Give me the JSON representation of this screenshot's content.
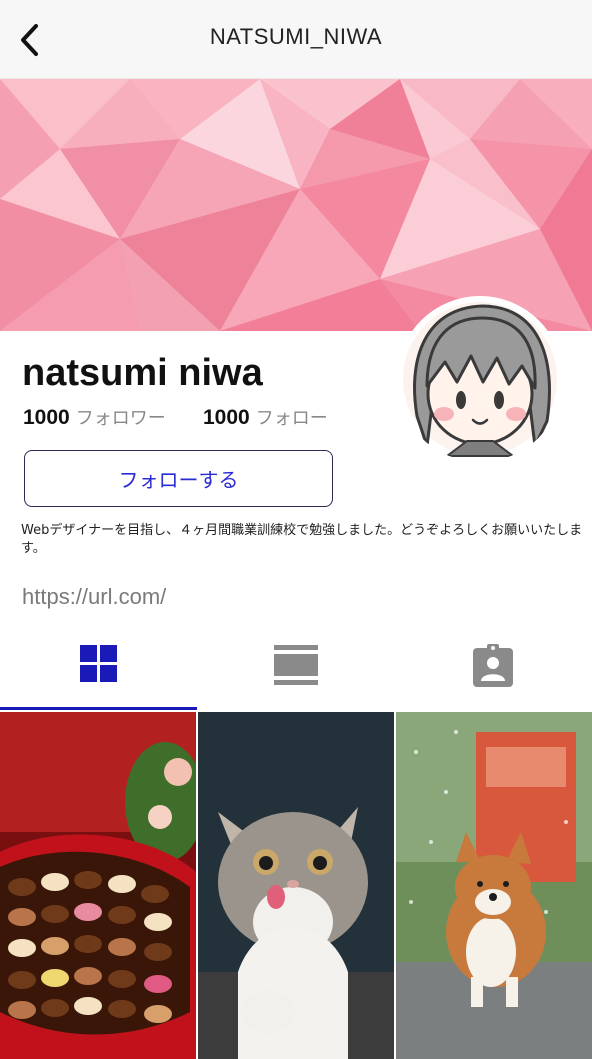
{
  "header": {
    "title": "NATSUMI_NIWA",
    "back_icon": "chevron-left-icon"
  },
  "profile": {
    "name": "natsumi niwa",
    "followers_count": "1000",
    "followers_label": "フォロワー",
    "following_count": "1000",
    "following_label": "フォロー",
    "follow_button_label": "フォローする",
    "bio": "Webデザイナーを目指し、４ヶ月間職業訓練校で勉強しました。どうぞよろしくお願いいたします。",
    "url": "https://url.com/"
  },
  "tabs": [
    {
      "icon": "grid-icon",
      "active": true
    },
    {
      "icon": "list-view-icon",
      "active": false
    },
    {
      "icon": "tagged-user-icon",
      "active": false
    }
  ],
  "posts": [
    {
      "icon": "chocolate-box-photo"
    },
    {
      "icon": "kitten-photo"
    },
    {
      "icon": "corgi-photo"
    }
  ],
  "colors": {
    "accent": "#1a1ab8",
    "cover_pink": "#f6a3b4",
    "muted_text": "#888888",
    "inactive_icon": "#8a8a8a"
  }
}
